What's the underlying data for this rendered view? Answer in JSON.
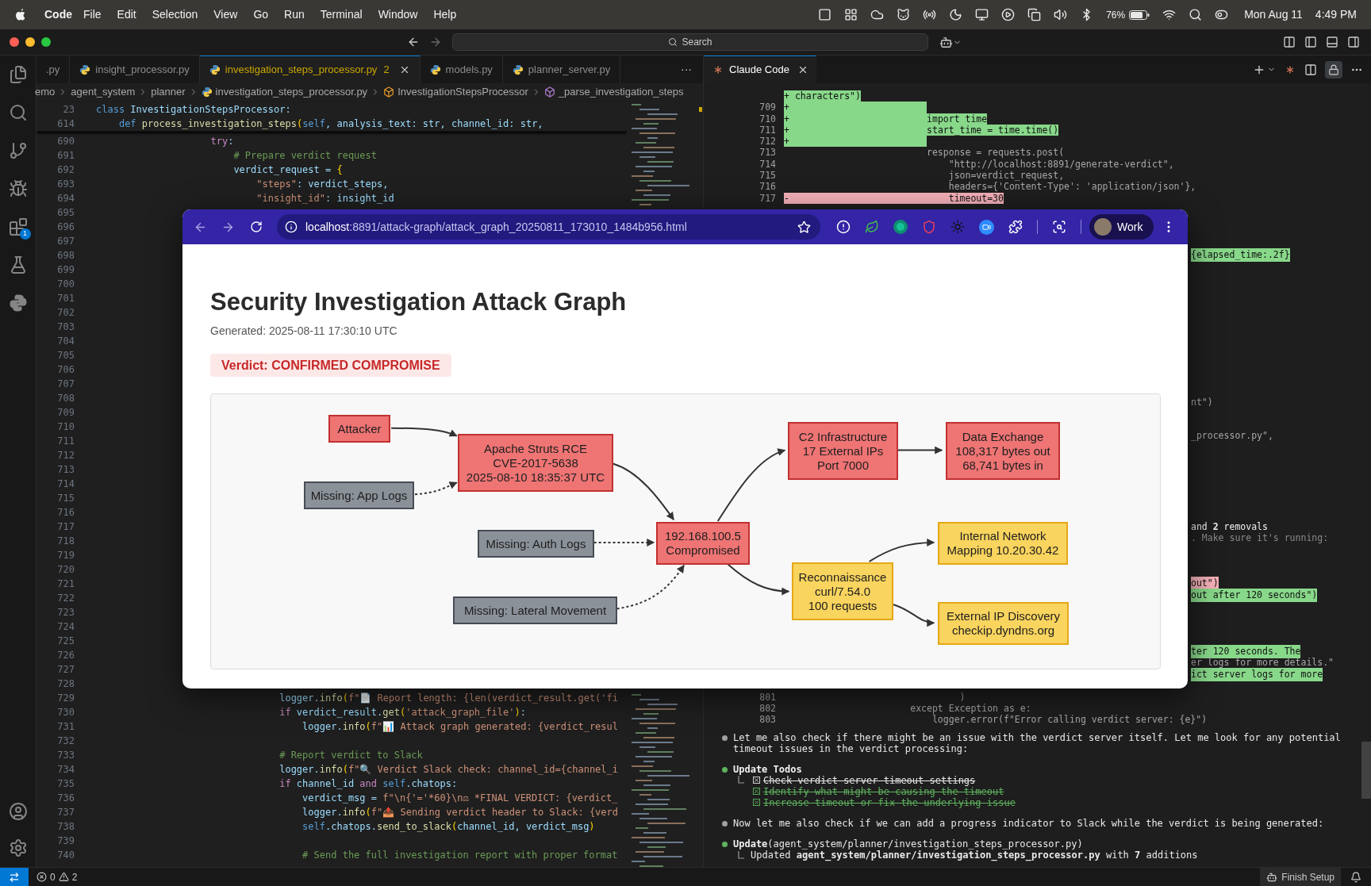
{
  "menu_bar": {
    "app": "Code",
    "menus": [
      "File",
      "Edit",
      "Selection",
      "View",
      "Go",
      "Run",
      "Terminal",
      "Window",
      "Help"
    ],
    "battery": "76%",
    "date": "Mon Aug 11",
    "time": "4:49 PM"
  },
  "title_bar": {
    "search": "Search"
  },
  "activity_bar": {
    "extensions_badge": "1"
  },
  "editor": {
    "tabs": [
      {
        "label": ".py",
        "selected": false,
        "warning": false
      },
      {
        "label": "insight_processor.py",
        "selected": false,
        "warning": false
      },
      {
        "label": "investigation_steps_processor.py",
        "badge": "2",
        "selected": true,
        "warning": true
      },
      {
        "label": "models.py",
        "selected": false,
        "warning": false
      },
      {
        "label": "planner_server.py",
        "selected": false,
        "warning": false
      }
    ],
    "more": "···",
    "breadcrumb": [
      {
        "kind": "folder",
        "label": "emo"
      },
      {
        "kind": "folder",
        "label": "agent_system"
      },
      {
        "kind": "folder",
        "label": "planner"
      },
      {
        "kind": "file",
        "label": "investigation_steps_processor.py"
      },
      {
        "kind": "class",
        "label": "InvestigationStepsProcessor"
      },
      {
        "kind": "method",
        "label": "_parse_investigation_steps"
      }
    ],
    "sticky_lines": [
      {
        "number": "23",
        "code": "class InvestigationStepsProcessor:"
      },
      {
        "number": "614",
        "code": "    def process_investigation_steps(self, analysis_text: str, channel_id: str,"
      }
    ],
    "lines": [
      {
        "number": "690",
        "code": "                    try:"
      },
      {
        "number": "691",
        "code": "                        # Prepare verdict request"
      },
      {
        "number": "692",
        "code": "                        verdict_request = {"
      },
      {
        "number": "693",
        "code": "                            \"steps\": verdict_steps,"
      },
      {
        "number": "694",
        "code": "                            \"insight_id\": insight_id"
      },
      {
        "number": "695"
      },
      {
        "number": "696"
      },
      {
        "number": "697"
      },
      {
        "number": "698"
      },
      {
        "number": "699"
      },
      {
        "number": "700"
      },
      {
        "number": "701"
      },
      {
        "number": "702"
      },
      {
        "number": "703"
      },
      {
        "number": "704"
      },
      {
        "number": "705"
      },
      {
        "number": "706"
      },
      {
        "number": "707"
      },
      {
        "number": "708"
      },
      {
        "number": "709"
      },
      {
        "number": "710"
      },
      {
        "number": "711"
      },
      {
        "number": "712"
      },
      {
        "number": "713"
      },
      {
        "number": "714"
      },
      {
        "number": "715"
      },
      {
        "number": "716"
      },
      {
        "number": "717"
      },
      {
        "number": "718"
      },
      {
        "number": "719"
      },
      {
        "number": "720"
      },
      {
        "number": "721"
      },
      {
        "number": "722"
      },
      {
        "number": "723"
      },
      {
        "number": "724"
      },
      {
        "number": "725"
      },
      {
        "number": "726"
      },
      {
        "number": "727"
      },
      {
        "number": "728"
      },
      {
        "number": "729",
        "code": "                                logger.info(f\"📄 Report length: {len(verdict_result.get('fi"
      },
      {
        "number": "730",
        "code": "                                if verdict_result.get('attack_graph_file'):"
      },
      {
        "number": "731",
        "code": "                                    logger.info(f\"📊 Attack graph generated: {verdict_resul"
      },
      {
        "number": "732"
      },
      {
        "number": "733",
        "code": "                                # Report verdict to Slack"
      },
      {
        "number": "734",
        "code": "                                logger.info(f\"🔍 Verdict Slack check: channel_id={channel_i"
      },
      {
        "number": "735",
        "code": "                                if channel_id and self.chatops:"
      },
      {
        "number": "736",
        "code": "                                    verdict_msg = f\"\\n{'='*60}\\n⚖ *FINAL VERDICT: {verdict_"
      },
      {
        "number": "737",
        "code": "                                    logger.info(f\"📤 Sending verdict header to Slack: {verd"
      },
      {
        "number": "738",
        "code": "                                    self.chatops.send_to_slack(channel_id, verdict_msg)"
      },
      {
        "number": "739"
      },
      {
        "number": "740",
        "code": "                                    # Send the full investigation report with proper format"
      }
    ]
  },
  "right_panel": {
    "tab": "Claude Code",
    "diff_rows": [
      {
        "marker": "+",
        "kind": "add",
        "text": "characters\")"
      },
      {
        "number": "709",
        "marker": "+",
        "kind": "add"
      },
      {
        "number": "710",
        "marker": "+",
        "kind": "add",
        "text": "                        import time"
      },
      {
        "number": "711",
        "marker": "+",
        "kind": "add",
        "text": "                        start_time = time.time()"
      },
      {
        "number": "712",
        "marker": "+",
        "kind": "add"
      },
      {
        "number": "713",
        "kind": "ctx",
        "text": "                        response = requests.post("
      },
      {
        "number": "714",
        "kind": "ctx",
        "text": "                            \"http://localhost:8891/generate-verdict\","
      },
      {
        "number": "715",
        "kind": "ctx",
        "text": "                            json=verdict_request,"
      },
      {
        "number": "716",
        "kind": "ctx",
        "text": "                            headers={'Content-Type': 'application/json'},"
      },
      {
        "number": "717",
        "marker": "-",
        "kind": "del",
        "text": "                            timeout=30"
      }
    ],
    "fragments": [
      {
        "kind": "add",
        "text": "{elapsed_time:.2f}"
      },
      {
        "kind": "ctx",
        "text": "nt\")"
      },
      {
        "kind": "ctx",
        "text": "_processor.py\","
      },
      {
        "kind": "text",
        "text": "and **2** removals"
      },
      {
        "kind": "muted",
        "text": ". Make sure it's running:"
      },
      {
        "kind": "del",
        "text": "out\")"
      },
      {
        "kind": "add",
        "text": "out after 120 seconds\")"
      },
      {
        "kind": "add",
        "text": "ter 120 seconds. The"
      },
      {
        "kind": "ctx",
        "text": "er logs for more details.\""
      },
      {
        "kind": "add",
        "text": "ict server logs for more"
      }
    ],
    "tail_rows": [
      {
        "number": "801",
        "kind": "ctx",
        "text": "                              )"
      },
      {
        "number": "802",
        "kind": "ctx",
        "text": "                     except Exception as e:"
      },
      {
        "number": "803",
        "kind": "ctx",
        "text": "                         logger.error(f\"Error calling verdict server: {e}\")"
      }
    ],
    "messages": [
      {
        "kind": "text",
        "color": "#a0a0a0",
        "text": "Let me also check if there might be an issue with the verdict server itself. Let me look for any potential timeout issues in the verdict processing:"
      },
      {
        "kind": "todos",
        "color": "#5fb35f",
        "title": "Update Todos",
        "items": [
          {
            "text": "Check verdict server timeout settings",
            "checked": true,
            "recent": false
          },
          {
            "text": "Identify what might be causing the timeout",
            "checked": true,
            "recent": true
          },
          {
            "text": "Increase timeout or fix the underlying issue",
            "checked": true,
            "recent": true
          }
        ]
      },
      {
        "kind": "text",
        "color": "#a0a0a0",
        "text": "Now let me also check if we can add a progress indicator to Slack while the verdict is being generated:"
      },
      {
        "kind": "tool",
        "color": "#5fb35f",
        "title": "Update",
        "args": "(agent_system/planner/investigation_steps_processor.py)",
        "result": "Updated **agent_system/planner/investigation_steps_processor.py** with **7** additions"
      }
    ]
  },
  "status_bar": {
    "errors": "0",
    "warnings": "2",
    "setup": "Finish Setup"
  },
  "browser": {
    "url_host": "localhost",
    "url_path": ":8891/attack-graph/attack_graph_20250811_173010_1484b956.html",
    "profile": "Work",
    "page": {
      "title": "Security Investigation Attack Graph",
      "generated": "Generated: 2025-08-11 17:30:10 UTC",
      "verdict": "Verdict: CONFIRMED COMPROMISE",
      "nodes": [
        {
          "kind": "threat",
          "lines": [
            "Attacker"
          ]
        },
        {
          "kind": "threat",
          "lines": [
            "Apache Struts RCE",
            "CVE-2017-5638",
            "2025-08-10 18:35:37 UTC"
          ]
        },
        {
          "kind": "missing",
          "lines": [
            "Missing: App Logs"
          ]
        },
        {
          "kind": "missing",
          "lines": [
            "Missing: Auth Logs"
          ]
        },
        {
          "kind": "threat",
          "lines": [
            "192.168.100.5",
            "Compromised"
          ]
        },
        {
          "kind": "missing",
          "lines": [
            "Missing: Lateral Movement"
          ]
        },
        {
          "kind": "threat",
          "lines": [
            "C2 Infrastructure",
            "17 External IPs",
            "Port 7000"
          ]
        },
        {
          "kind": "threat",
          "lines": [
            "Data Exchange",
            "108,317 bytes out",
            "68,741 bytes in"
          ]
        },
        {
          "kind": "recon",
          "lines": [
            "Reconnaissance",
            "curl/7.54.0",
            "100 requests"
          ]
        },
        {
          "kind": "recon",
          "lines": [
            "Internal Network",
            "Mapping 10.20.30.42"
          ]
        },
        {
          "kind": "recon",
          "lines": [
            "External IP Discovery",
            "checkip.dyndns.org"
          ]
        }
      ]
    }
  }
}
